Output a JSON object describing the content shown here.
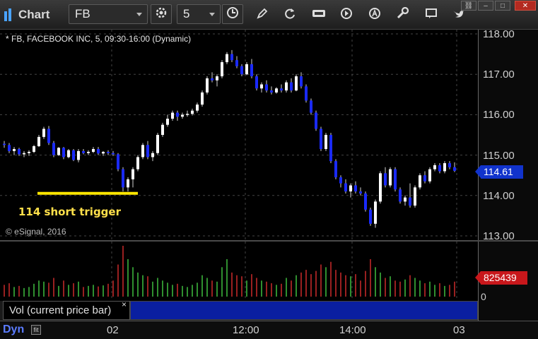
{
  "app": {
    "title": "Chart"
  },
  "toolbar": {
    "symbol": "FB",
    "interval": "5",
    "icons": [
      "settings-icon",
      "clock-icon",
      "pencil-icon",
      "refresh-icon",
      "data-icon",
      "play-icon",
      "text-a-icon",
      "gear-icon",
      "chat-icon",
      "twitter-icon"
    ]
  },
  "window": {
    "buttons": [
      "link",
      "minimize",
      "maximize",
      "close"
    ]
  },
  "chart": {
    "symbol_description": "* FB, FACEBOOK INC, 5, 09:30-16:00 (Dynamic)",
    "copyright": "© eSignal, 2016",
    "annotation": "114 short trigger",
    "last_price": "114.61",
    "price_labels": [
      "118.00",
      "117.00",
      "116.00",
      "115.00",
      "114.00",
      "113.00"
    ],
    "colors": {
      "up": "#ffffff",
      "down": "#1a2aff",
      "trigger_line": "#ffe600"
    }
  },
  "volume": {
    "legend": "Vol (current price bar)",
    "close_glyph": "×",
    "last_volume": "825439",
    "zero_label": "0"
  },
  "time_axis": {
    "labels": [
      "02",
      "12:00",
      "14:00",
      "03"
    ],
    "mode_label": "Dyn",
    "mode_box": "fit"
  },
  "chart_data": {
    "type": "candlestick",
    "price_axis": [
      113.0,
      118.0
    ],
    "trigger_level": 114.0,
    "candles": [
      [
        115.28,
        115.35,
        115.18,
        115.25
      ],
      [
        115.25,
        115.3,
        115.05,
        115.1
      ],
      [
        115.1,
        115.2,
        115.0,
        115.15
      ],
      [
        115.15,
        115.18,
        114.98,
        115.02
      ],
      [
        115.02,
        115.1,
        114.95,
        115.05
      ],
      [
        115.05,
        115.12,
        114.98,
        115.08
      ],
      [
        115.08,
        115.25,
        115.05,
        115.22
      ],
      [
        115.22,
        115.5,
        115.2,
        115.45
      ],
      [
        115.45,
        115.7,
        115.4,
        115.65
      ],
      [
        115.65,
        115.72,
        115.25,
        115.3
      ],
      [
        115.3,
        115.35,
        114.95,
        115.0
      ],
      [
        115.0,
        115.2,
        114.98,
        115.18
      ],
      [
        115.18,
        115.2,
        114.9,
        114.95
      ],
      [
        114.95,
        115.15,
        114.92,
        115.12
      ],
      [
        115.12,
        115.15,
        114.85,
        114.88
      ],
      [
        114.88,
        115.15,
        114.82,
        115.1
      ],
      [
        115.1,
        115.15,
        115.02,
        115.05
      ],
      [
        115.05,
        115.12,
        115.0,
        115.08
      ],
      [
        115.08,
        115.2,
        115.05,
        115.15
      ],
      [
        115.15,
        115.2,
        115.0,
        115.04
      ],
      [
        115.04,
        115.1,
        114.98,
        115.08
      ],
      [
        115.08,
        115.12,
        115.0,
        115.05
      ],
      [
        115.05,
        115.1,
        114.98,
        115.02
      ],
      [
        115.02,
        115.05,
        114.6,
        114.65
      ],
      [
        114.65,
        114.7,
        114.1,
        114.2
      ],
      [
        114.2,
        114.45,
        114.1,
        114.4
      ],
      [
        114.4,
        114.7,
        114.2,
        114.65
      ],
      [
        114.65,
        115.0,
        114.6,
        114.95
      ],
      [
        114.95,
        115.3,
        114.9,
        115.25
      ],
      [
        115.25,
        115.35,
        114.9,
        114.95
      ],
      [
        114.95,
        115.1,
        114.85,
        115.05
      ],
      [
        115.05,
        115.55,
        115.0,
        115.5
      ],
      [
        115.5,
        115.8,
        115.45,
        115.75
      ],
      [
        115.75,
        116.0,
        115.7,
        115.9
      ],
      [
        115.9,
        116.1,
        115.85,
        116.05
      ],
      [
        116.05,
        116.1,
        115.85,
        115.95
      ],
      [
        115.95,
        116.05,
        115.9,
        116.0
      ],
      [
        116.0,
        116.1,
        115.95,
        116.02
      ],
      [
        116.02,
        116.15,
        115.98,
        116.1
      ],
      [
        116.1,
        116.3,
        116.05,
        116.25
      ],
      [
        116.25,
        116.6,
        116.2,
        116.55
      ],
      [
        116.55,
        116.95,
        116.5,
        116.9
      ],
      [
        116.9,
        117.05,
        116.8,
        116.85
      ],
      [
        116.85,
        117.0,
        116.7,
        116.95
      ],
      [
        116.95,
        117.35,
        116.9,
        117.3
      ],
      [
        117.3,
        117.55,
        117.25,
        117.5
      ],
      [
        117.5,
        117.6,
        117.3,
        117.35
      ],
      [
        117.35,
        117.45,
        117.15,
        117.2
      ],
      [
        117.2,
        117.25,
        116.95,
        117.0
      ],
      [
        117.0,
        117.3,
        116.98,
        117.25
      ],
      [
        117.25,
        117.38,
        116.9,
        116.95
      ],
      [
        116.95,
        117.0,
        116.6,
        116.65
      ],
      [
        116.65,
        116.8,
        116.55,
        116.75
      ],
      [
        116.75,
        116.85,
        116.55,
        116.6
      ],
      [
        116.6,
        116.7,
        116.5,
        116.55
      ],
      [
        116.55,
        116.68,
        116.52,
        116.65
      ],
      [
        116.65,
        116.75,
        116.55,
        116.6
      ],
      [
        116.6,
        116.85,
        116.55,
        116.8
      ],
      [
        116.8,
        116.9,
        116.55,
        116.6
      ],
      [
        116.6,
        117.0,
        116.58,
        116.95
      ],
      [
        116.95,
        117.05,
        116.65,
        116.7
      ],
      [
        116.7,
        116.75,
        116.3,
        116.35
      ],
      [
        116.35,
        116.4,
        116.0,
        116.05
      ],
      [
        116.05,
        116.1,
        115.6,
        115.65
      ],
      [
        115.65,
        115.7,
        115.1,
        115.15
      ],
      [
        115.15,
        115.55,
        115.1,
        115.5
      ],
      [
        115.5,
        115.55,
        114.8,
        114.85
      ],
      [
        114.85,
        114.9,
        114.4,
        114.45
      ],
      [
        114.45,
        114.5,
        114.2,
        114.3
      ],
      [
        114.3,
        114.4,
        114.05,
        114.1
      ],
      [
        114.1,
        114.3,
        113.95,
        114.25
      ],
      [
        114.25,
        114.35,
        114.05,
        114.1
      ],
      [
        114.1,
        114.2,
        114.0,
        114.05
      ],
      [
        114.05,
        114.1,
        113.6,
        113.65
      ],
      [
        113.65,
        113.7,
        113.25,
        113.3
      ],
      [
        113.3,
        113.9,
        113.2,
        113.85
      ],
      [
        113.85,
        114.6,
        113.8,
        114.55
      ],
      [
        114.55,
        114.7,
        114.2,
        114.25
      ],
      [
        114.25,
        114.7,
        114.2,
        114.65
      ],
      [
        114.65,
        114.7,
        114.1,
        114.15
      ],
      [
        114.15,
        114.2,
        113.8,
        113.85
      ],
      [
        113.85,
        114.0,
        113.75,
        113.95
      ],
      [
        113.95,
        114.3,
        113.7,
        113.75
      ],
      [
        113.75,
        114.25,
        113.7,
        114.2
      ],
      [
        114.2,
        114.55,
        114.15,
        114.5
      ],
      [
        114.5,
        114.6,
        114.3,
        114.35
      ],
      [
        114.35,
        114.7,
        114.3,
        114.65
      ],
      [
        114.65,
        114.8,
        114.6,
        114.75
      ],
      [
        114.75,
        114.8,
        114.55,
        114.6
      ],
      [
        114.6,
        114.85,
        114.55,
        114.8
      ],
      [
        114.8,
        114.85,
        114.65,
        114.7
      ],
      [
        114.7,
        114.82,
        114.58,
        114.61
      ]
    ],
    "volume": [
      22,
      25,
      18,
      20,
      16,
      18,
      24,
      30,
      28,
      26,
      35,
      20,
      30,
      22,
      25,
      28,
      18,
      20,
      22,
      19,
      21,
      24,
      30,
      60,
      95,
      70,
      55,
      45,
      40,
      38,
      28,
      35,
      30,
      26,
      22,
      24,
      20,
      18,
      22,
      26,
      40,
      35,
      30,
      28,
      55,
      70,
      45,
      40,
      38,
      30,
      42,
      35,
      30,
      28,
      25,
      22,
      24,
      35,
      30,
      40,
      45,
      50,
      42,
      48,
      60,
      55,
      65,
      50,
      45,
      40,
      38,
      42,
      30,
      48,
      70,
      55,
      45,
      35,
      38,
      30,
      28,
      32,
      40,
      35,
      30,
      25,
      28,
      22,
      25,
      20,
      22,
      28
    ]
  }
}
